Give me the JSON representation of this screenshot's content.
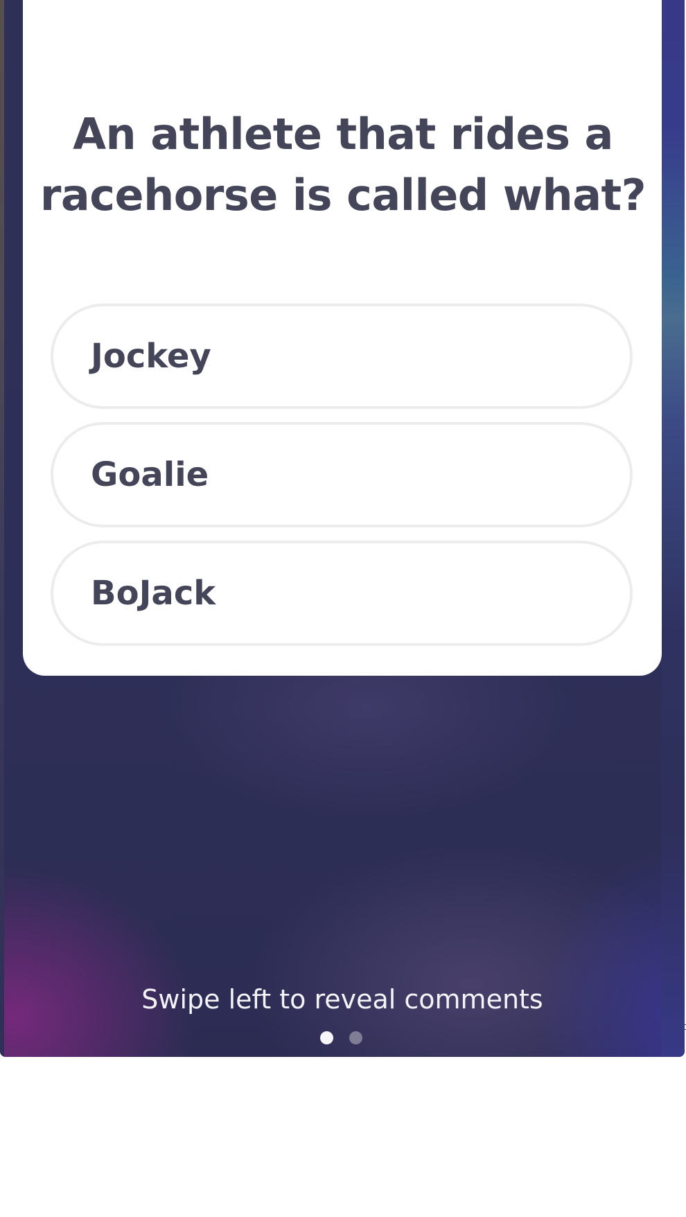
{
  "question": {
    "text": "An athlete that rides a racehorse is called what?"
  },
  "options": [
    {
      "label": "Jockey"
    },
    {
      "label": "Goalie"
    },
    {
      "label": "BoJack"
    }
  ],
  "footer": {
    "hint": "Swipe left to reveal comments",
    "page_indicator": {
      "current": 1,
      "total": 2
    }
  },
  "colors": {
    "text_dark": "#45455a",
    "card": "#ffffff",
    "background": "#2e2f58",
    "option_border": "#ececec"
  },
  "icons": {
    "avatar": "host-avatar"
  }
}
